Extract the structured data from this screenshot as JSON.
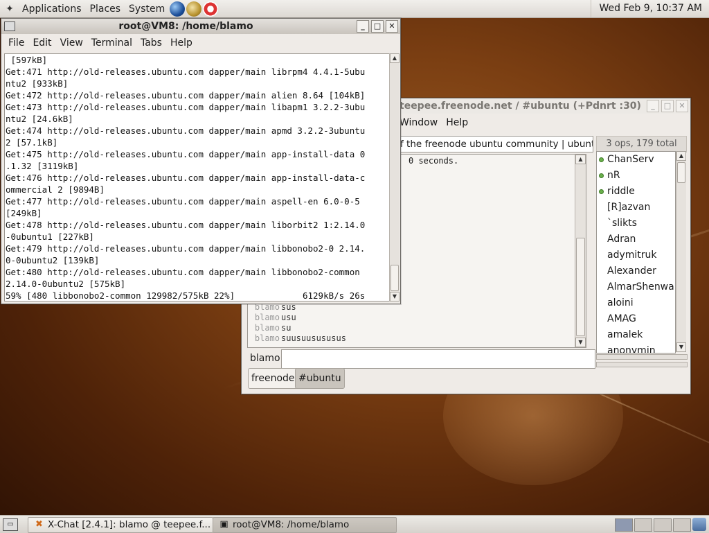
{
  "top_panel": {
    "menus": [
      "Applications",
      "Places",
      "System"
    ],
    "launchers": [
      "web-browser-icon",
      "mail-icon",
      "help-icon"
    ],
    "clock": "Wed Feb  9, 10:37 AM"
  },
  "terminal": {
    "title": "root@VM8: /home/blamo",
    "menu": [
      "File",
      "Edit",
      "View",
      "Terminal",
      "Tabs",
      "Help"
    ],
    "lines": [
      " [597kB]",
      "Get:471 http://old-releases.ubuntu.com dapper/main librpm4 4.4.1-5ubu",
      "ntu2 [933kB]",
      "Get:472 http://old-releases.ubuntu.com dapper/main alien 8.64 [104kB]",
      "Get:473 http://old-releases.ubuntu.com dapper/main libapm1 3.2.2-3ubu",
      "ntu2 [24.6kB]",
      "Get:474 http://old-releases.ubuntu.com dapper/main apmd 3.2.2-3ubuntu",
      "2 [57.1kB]",
      "Get:475 http://old-releases.ubuntu.com dapper/main app-install-data 0",
      ".1.32 [3119kB]",
      "Get:476 http://old-releases.ubuntu.com dapper/main app-install-data-c",
      "ommercial 2 [9894B]",
      "Get:477 http://old-releases.ubuntu.com dapper/main aspell-en 6.0-0-5",
      "[249kB]",
      "Get:478 http://old-releases.ubuntu.com dapper/main liborbit2 1:2.14.0",
      "-0ubuntu1 [227kB]",
      "Get:479 http://old-releases.ubuntu.com dapper/main libbonobo2-0 2.14.",
      "0-0ubuntu2 [139kB]",
      "Get:480 http://old-releases.ubuntu.com dapper/main libbonobo2-common",
      "2.14.0-0ubuntu2 [575kB]",
      "59% [480 libbonobo2-common 129982/575kB 22%]             6129kB/s 26s"
    ]
  },
  "xchat": {
    "title": "teepee.freenode.net / #ubuntu (+Pdnrt :30)",
    "menu": [
      "Window",
      "Help"
    ],
    "topic": "f the freenode ubuntu community | ubuntu",
    "ops_count": "3 ops, 179 total",
    "chat_top_text": "0 seconds.",
    "chat_lines": [
      {
        "nick": "blamo",
        "msg": "sus"
      },
      {
        "nick": "blamo",
        "msg": "usu"
      },
      {
        "nick": "blamo",
        "msg": "su"
      },
      {
        "nick": "blamo",
        "msg": "suusuusususus"
      }
    ],
    "users": [
      {
        "name": "ChanServ",
        "op": true
      },
      {
        "name": "nR",
        "op": true
      },
      {
        "name": "riddle",
        "op": true
      },
      {
        "name": "[R]azvan",
        "op": false
      },
      {
        "name": "`slikts",
        "op": false
      },
      {
        "name": "Adran",
        "op": false
      },
      {
        "name": "adymitruk",
        "op": false
      },
      {
        "name": "Alexander",
        "op": false
      },
      {
        "name": "AlmarShenwar",
        "op": false
      },
      {
        "name": "aloini",
        "op": false
      },
      {
        "name": "AMAG",
        "op": false
      },
      {
        "name": "amalek",
        "op": false
      },
      {
        "name": "anonymin",
        "op": false
      }
    ],
    "nick": "blamo",
    "input_value": "",
    "tabs": [
      "freenode",
      "#ubuntu"
    ],
    "selected_tab": "#ubuntu"
  },
  "taskbar": {
    "items": [
      {
        "label": "X-Chat [2.4.1]: blamo @ teepee.f...",
        "icon": "xchat-icon"
      },
      {
        "label": "root@VM8: /home/blamo",
        "icon": "terminal-icon"
      }
    ]
  }
}
